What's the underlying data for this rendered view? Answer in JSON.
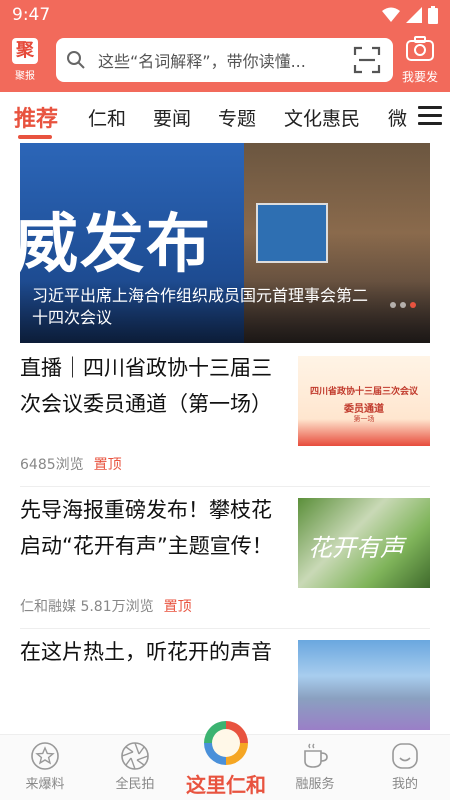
{
  "status_bar": {
    "time": "9:47"
  },
  "header": {
    "logo_label": "聚报",
    "logo_glyph": "聚",
    "search_placeholder": "这些“名词解释”，带你读懂...",
    "camera_label": "我要发",
    "accent_color": "#f26a5b"
  },
  "tabs": [
    {
      "label": "推荐",
      "active": true
    },
    {
      "label": "仁和"
    },
    {
      "label": "要闻"
    },
    {
      "label": "专题"
    },
    {
      "label": "文化惠民"
    },
    {
      "label": "微"
    }
  ],
  "banner": {
    "headline": "威发布",
    "caption": "习近平出席上海合作组织成员国元首理事会第二十四次会议",
    "slide_count": 3,
    "active_slide": 3
  },
  "news": [
    {
      "title": "直播｜四川省政协十三届三次会议委员通道（第一场）",
      "meta": "6485浏览",
      "pin": "置顶",
      "thumb_line1": "四川省政协十三届三次会议",
      "thumb_line2": "委员通道",
      "thumb_line3": "第一场"
    },
    {
      "title": "先导海报重磅发布！攀枝花启动“花开有声”主题宣传！",
      "meta": "仁和融媒 5.81万浏览",
      "pin": "置顶",
      "thumb_text": "花开有声"
    },
    {
      "title": "在这片热土，听花开的声音"
    }
  ],
  "bottom_nav": [
    {
      "label": "来爆料",
      "icon": "star-icon"
    },
    {
      "label": "全民拍",
      "icon": "aperture-icon"
    },
    {
      "label": "这里仁和",
      "icon": "home-logo-icon"
    },
    {
      "label": "融服务",
      "icon": "cup-icon"
    },
    {
      "label": "我的",
      "icon": "smile-icon"
    }
  ]
}
